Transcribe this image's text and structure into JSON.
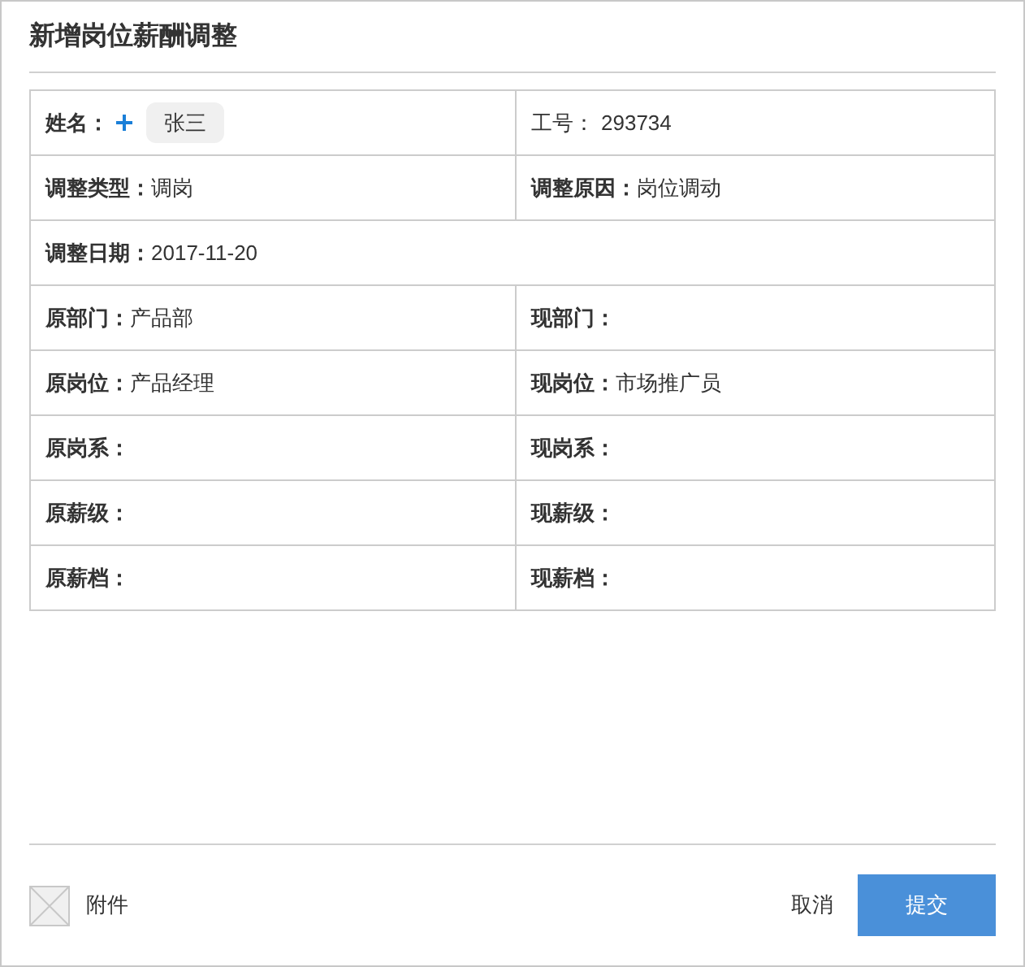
{
  "title": "新增岗位薪酬调整",
  "rows": [
    [
      {
        "kind": "name",
        "label": "姓名：",
        "value": "张三"
      },
      {
        "kind": "plain",
        "label": "工号：",
        "value": "293734"
      }
    ],
    [
      {
        "kind": "field",
        "label": "调整类型：",
        "value": "调岗"
      },
      {
        "kind": "field",
        "label": "调整原因：",
        "value": "岗位调动"
      }
    ],
    [
      {
        "kind": "field",
        "label": "调整日期：",
        "value": "2017-11-20"
      }
    ],
    [
      {
        "kind": "field",
        "label": "原部门：",
        "value": "产品部"
      },
      {
        "kind": "field",
        "label": "现部门："
      }
    ],
    [
      {
        "kind": "field",
        "label": "原岗位：",
        "value": "产品经理"
      },
      {
        "kind": "field",
        "label": "现岗位：",
        "value": "市场推广员"
      }
    ],
    [
      {
        "kind": "field",
        "label": "原岗系："
      },
      {
        "kind": "field",
        "label": "现岗系："
      }
    ],
    [
      {
        "kind": "field",
        "label": "原薪级："
      },
      {
        "kind": "field",
        "label": "现薪级："
      }
    ],
    [
      {
        "kind": "field",
        "label": "原薪档："
      },
      {
        "kind": "field",
        "label": "现薪档："
      }
    ]
  ],
  "footer": {
    "attachment": "附件",
    "cancel": "取消",
    "submit": "提交"
  }
}
